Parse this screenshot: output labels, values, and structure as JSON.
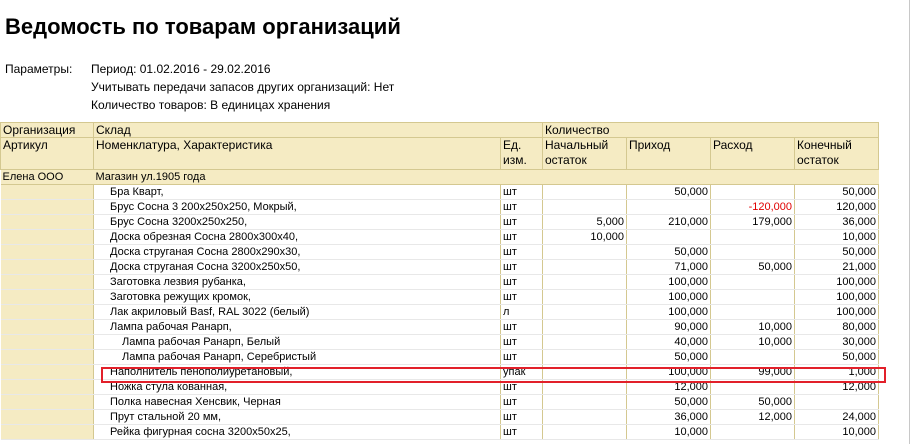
{
  "report": {
    "title": "Ведомость по товарам организаций",
    "params_label": "Параметры:",
    "params": [
      "Период: 01.02.2016 - 29.02.2016",
      "Учитывать передачи запасов других организаций: Нет",
      "Количество товаров: В единицах хранения"
    ]
  },
  "table": {
    "headers": {
      "org": "Организация",
      "warehouse": "Склад",
      "quantity": "Количество",
      "article": "Артикул",
      "nomenclature": "Номенклатура, Характеристика",
      "unit_l1": "Ед.",
      "unit_l2": "изм.",
      "start_l1": "Начальный",
      "start_l2": "остаток",
      "income": "Приход",
      "expense": "Расход",
      "end_l1": "Конечный",
      "end_l2": "остаток"
    },
    "group": {
      "org": "Елена ООО",
      "warehouse": "Магазин ул.1905 года"
    },
    "rows": [
      {
        "name": "Бра Кварт,",
        "unit": "шт",
        "start": "",
        "income": "50,000",
        "expense": "",
        "end": "50,000"
      },
      {
        "name": "Брус Сосна 3 200х250х250, Мокрый,",
        "unit": "шт",
        "start": "",
        "income": "",
        "expense": "-120,000",
        "end": "120,000"
      },
      {
        "name": "Брус Сосна 3200х250х250,",
        "unit": "шт",
        "start": "5,000",
        "income": "210,000",
        "expense": "179,000",
        "end": "36,000"
      },
      {
        "name": "Доска обрезная Сосна 2800х300х40,",
        "unit": "шт",
        "start": "10,000",
        "income": "",
        "expense": "",
        "end": "10,000"
      },
      {
        "name": "Доска струганая Сосна 2800х290х30,",
        "unit": "шт",
        "start": "",
        "income": "50,000",
        "expense": "",
        "end": "50,000"
      },
      {
        "name": "Доска струганая Сосна 3200х250х50,",
        "unit": "шт",
        "start": "",
        "income": "71,000",
        "expense": "50,000",
        "end": "21,000"
      },
      {
        "name": "Заготовка лезвия рубанка,",
        "unit": "шт",
        "start": "",
        "income": "100,000",
        "expense": "",
        "end": "100,000"
      },
      {
        "name": "Заготовка режущих кромок,",
        "unit": "шт",
        "start": "",
        "income": "100,000",
        "expense": "",
        "end": "100,000"
      },
      {
        "name": "Лак акриловый Basf, RAL 3022 (белый)",
        "unit": "л",
        "start": "",
        "income": "100,000",
        "expense": "",
        "end": "100,000"
      },
      {
        "name": "Лампа рабочая Ранарп,",
        "unit": "шт",
        "start": "",
        "income": "90,000",
        "expense": "10,000",
        "end": "80,000"
      },
      {
        "name": "Лампа рабочая Ранарп, Белый",
        "unit": "шт",
        "start": "",
        "income": "40,000",
        "expense": "10,000",
        "end": "30,000"
      },
      {
        "name": "Лампа рабочая Ранарп, Серебристый",
        "unit": "шт",
        "start": "",
        "income": "50,000",
        "expense": "",
        "end": "50,000"
      },
      {
        "name": "Наполнитель пенополиуретановый,",
        "unit": "упак",
        "start": "",
        "income": "100,000",
        "expense": "99,000",
        "end": "1,000"
      },
      {
        "name": "Ножка стула кованная,",
        "unit": "шт",
        "start": "",
        "income": "12,000",
        "expense": "",
        "end": "12,000"
      },
      {
        "name": "Полка навесная Хенсвик, Черная",
        "unit": "шт",
        "start": "",
        "income": "50,000",
        "expense": "50,000",
        "end": ""
      },
      {
        "name": "Прут стальной 20 мм,",
        "unit": "шт",
        "start": "",
        "income": "36,000",
        "expense": "12,000",
        "end": "24,000"
      },
      {
        "name": "Рейка фигурная сосна 3200х50х25,",
        "unit": "шт",
        "start": "",
        "income": "10,000",
        "expense": "",
        "end": "10,000"
      }
    ]
  },
  "colors": {
    "header_bg": "#f5ebc3",
    "negative": "#e00000",
    "highlight": "#e2202a"
  }
}
